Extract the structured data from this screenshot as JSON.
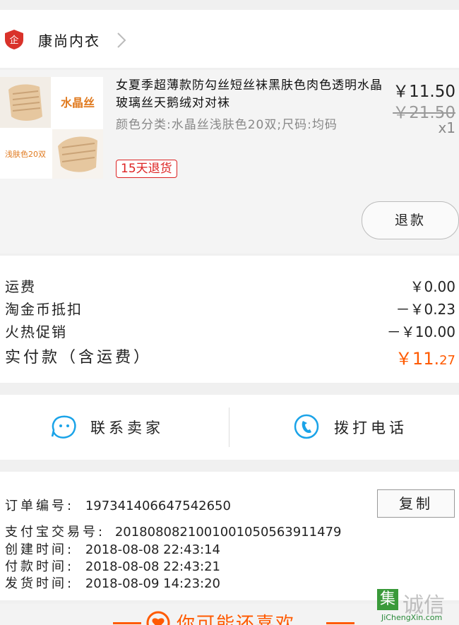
{
  "shop": {
    "name": "康尚内衣",
    "logo_icon": "shop-badge-icon",
    "arrow_icon": "chevron-right-icon"
  },
  "item": {
    "title": "女夏季超薄款防勾丝短丝袜黑肤色肉色透明水晶玻璃丝天鹅绒对对袜",
    "spec": "颜色分类:水晶丝浅肤色20双;尺码:均码",
    "tag": "15天退货",
    "price": "￥11.50",
    "original_price": "￥21.50",
    "quantity": "x1",
    "thumb_label_top": "水晶丝",
    "thumb_label_bottom": "浅肤色20双",
    "refund_label": "退款"
  },
  "fees": {
    "shipping_label": "运费",
    "shipping_value": "￥0.00",
    "coin_label": "淘金币抵扣",
    "coin_value": "－￥0.23",
    "promo_label": "火热促销",
    "promo_value": "－￥10.00",
    "total_label": "实付款（含运费）",
    "total_value_main": "￥11.",
    "total_value_cents": "27"
  },
  "contact": {
    "seller_label": "联系卖家",
    "call_label": "拨打电话",
    "accent": "#1aa3e8"
  },
  "order": {
    "order_no_label": "订单编号:",
    "order_no": "197341406647542650",
    "copy_label": "复制",
    "alipay_label": "支付宝交易号:",
    "alipay_no": "2018080821001001050563911479",
    "created_label": "创建时间:",
    "created": "2018-08-08 22:43:14",
    "paid_label": "付款时间:",
    "paid": "2018-08-08 22:43:21",
    "shipped_label": "发货时间:",
    "shipped": "2018-08-09 14:23:20"
  },
  "recommend": {
    "title": "你可能还喜欢"
  },
  "watermark": {
    "mark": "集",
    "name": "诚信",
    "url": "JiChengXin.com"
  },
  "colors": {
    "accent_orange": "#ff5a00",
    "tag_red": "#dd2222",
    "shop_red": "#d9322a"
  }
}
